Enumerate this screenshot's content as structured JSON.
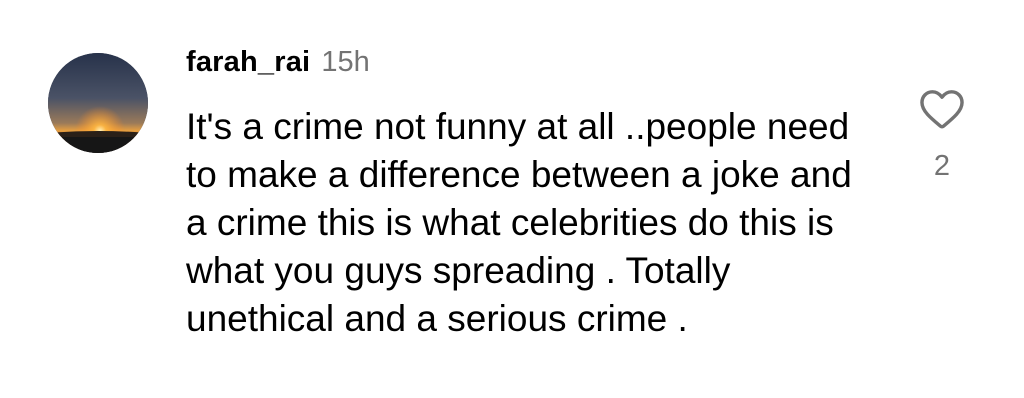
{
  "comment": {
    "username": "farah_rai",
    "timestamp": "15h",
    "text": "It's a crime not funny at all ..people need to make a difference between a joke and a crime this is what celebrities do this is what you guys spreading . Totally unethical and a serious crime .",
    "like_count": "2",
    "avatar_icon": "sunset-photo",
    "like_icon": "heart-outline-icon"
  },
  "colors": {
    "text": "#000000",
    "secondary_text": "#737373",
    "background": "#ffffff"
  }
}
